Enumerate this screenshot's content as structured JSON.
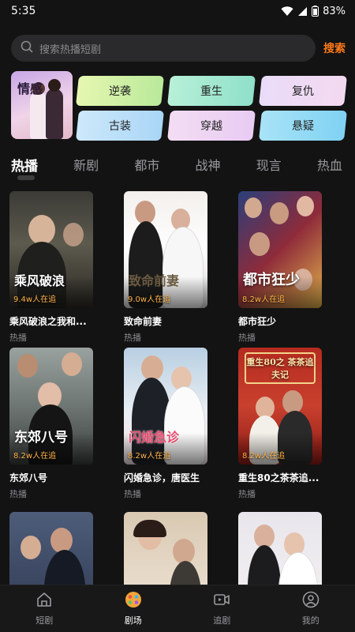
{
  "status": {
    "time": "5:35",
    "battery": "83%"
  },
  "search": {
    "placeholder": "搜索热播短剧",
    "button": "搜索"
  },
  "genres": {
    "featured": "情感",
    "chips": [
      "逆袭",
      "重生",
      "复仇",
      "古装",
      "穿越",
      "悬疑"
    ]
  },
  "tabs": [
    "热播",
    "新剧",
    "都市",
    "战神",
    "现言",
    "热血"
  ],
  "dramas": [
    {
      "name": "乘风破浪之我和...",
      "tag": "热播",
      "views": "9.4w人在追",
      "poster_text": "乘风破浪"
    },
    {
      "name": "致命前妻",
      "tag": "热播",
      "views": "9.0w人在追",
      "poster_text": "致命前妻"
    },
    {
      "name": "都市狂少",
      "tag": "热播",
      "views": "8.2w人在追",
      "poster_text": "都市狂少"
    },
    {
      "name": "东郊八号",
      "tag": "热播",
      "views": "8.2w人在追",
      "poster_text": "东郊八号"
    },
    {
      "name": "闪婚急诊，唐医生",
      "tag": "热播",
      "views": "8.2w人在追",
      "poster_text": "闪婚急诊"
    },
    {
      "name": "重生80之茶茶追...",
      "tag": "热播",
      "views": "8.2w人在追",
      "poster_text": "重生80之 茶茶追夫记"
    },
    {
      "name": "",
      "tag": "",
      "views": "",
      "poster_text": ""
    },
    {
      "name": "",
      "tag": "",
      "views": "",
      "poster_text": ""
    },
    {
      "name": "",
      "tag": "",
      "views": "",
      "poster_text": ""
    }
  ],
  "nav": [
    {
      "label": "短剧",
      "icon": "home-icon"
    },
    {
      "label": "剧场",
      "icon": "theater-icon"
    },
    {
      "label": "追剧",
      "icon": "video-icon"
    },
    {
      "label": "我的",
      "icon": "user-icon"
    }
  ]
}
